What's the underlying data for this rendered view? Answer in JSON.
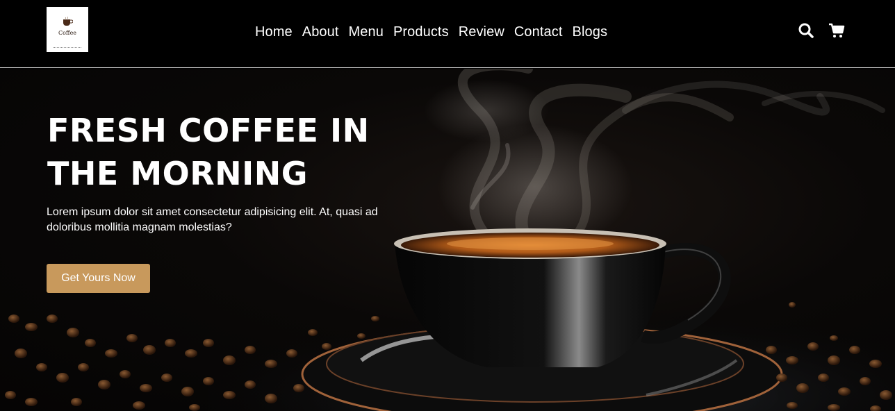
{
  "brand": {
    "logo_text": "Coffee"
  },
  "nav": {
    "items": [
      {
        "label": "Home"
      },
      {
        "label": "About"
      },
      {
        "label": "Menu"
      },
      {
        "label": "Products"
      },
      {
        "label": "Review"
      },
      {
        "label": "Contact"
      },
      {
        "label": "Blogs"
      }
    ]
  },
  "header_icons": {
    "search": "search-icon",
    "cart": "cart-icon"
  },
  "hero": {
    "title": "FRESH COFFEE IN THE MORNING",
    "description": "Lorem ipsum dolor sit amet consectetur adipisicing elit. At, quasi ad doloribus mollitia magnam molestias?",
    "cta_label": "Get Yours Now"
  },
  "colors": {
    "background": "#000000",
    "accent": "#c8995c",
    "text": "#ffffff"
  }
}
